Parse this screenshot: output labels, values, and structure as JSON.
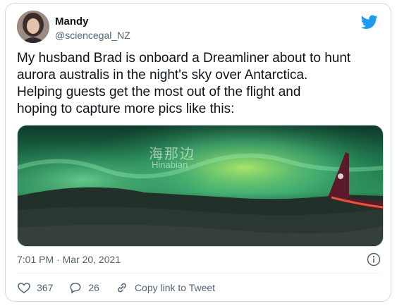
{
  "author": {
    "name": "Mandy",
    "handle": "@sciencegal_NZ",
    "avatar_icon": "avatar-photo",
    "brand_icon": "twitter-bird-icon",
    "brand_color": "#1d9bf0"
  },
  "tweet": {
    "text": "My husband Brad is onboard a Dreamliner about to hunt\naurora australis in the night's sky over Antarctica.\nHelping guests get the most out of the flight and\nhoping to capture more pics like this:",
    "timestamp": "7:01 PM · Mar 20, 2021"
  },
  "media": {
    "watermark_cn": "海那边",
    "watermark_en": "Hinabian"
  },
  "actions": {
    "like_count": "367",
    "reply_count": "26",
    "copy_link_label": "Copy link to Tweet"
  }
}
